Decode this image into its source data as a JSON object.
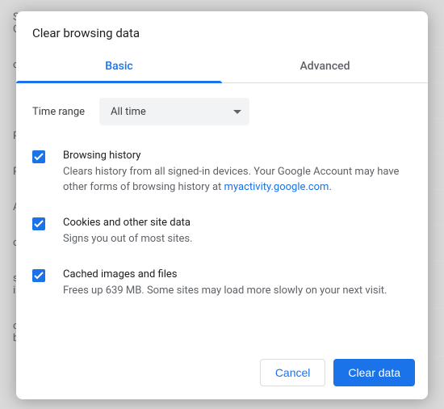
{
  "background_items": [
    "Sync",
    "oo",
    "",
    "P",
    "P",
    "A",
    "ce",
    "s",
    "ome"
  ],
  "dialog": {
    "title": "Clear browsing data",
    "tabs": {
      "basic": "Basic",
      "advanced": "Advanced",
      "active": "basic"
    },
    "time_range": {
      "label": "Time range",
      "value": "All time"
    },
    "options": [
      {
        "title": "Browsing history",
        "desc_pre": "Clears history from all signed-in devices. Your Google Account may have other forms of browsing history at ",
        "link": "myactivity.google.com",
        "desc_post": ".",
        "checked": true
      },
      {
        "title": "Cookies and other site data",
        "desc": "Signs you out of most sites.",
        "checked": true
      },
      {
        "title": "Cached images and files",
        "desc": "Frees up 639 MB. Some sites may load more slowly on your next visit.",
        "checked": true
      }
    ],
    "buttons": {
      "cancel": "Cancel",
      "clear": "Clear data"
    }
  }
}
